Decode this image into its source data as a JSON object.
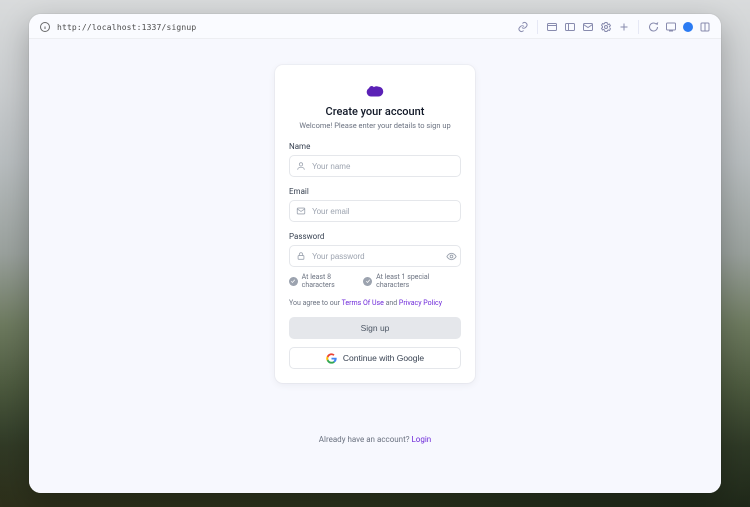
{
  "browser": {
    "url": "http://localhost:1337/signup"
  },
  "form": {
    "title": "Create your account",
    "subtitle": "Welcome! Please enter your details to sign up",
    "name_label": "Name",
    "name_placeholder": "Your name",
    "email_label": "Email",
    "email_placeholder": "Your email",
    "password_label": "Password",
    "password_placeholder": "Your password",
    "req1": "At least 8 characters",
    "req2": "At least 1 special characters",
    "agree_prefix": "You agree to our ",
    "terms_label": "Terms Of Use",
    "agree_mid": " and ",
    "privacy_label": "Privacy Policy",
    "signup_label": "Sign up",
    "google_label": "Continue with Google"
  },
  "footer": {
    "prompt": "Already have an account? ",
    "login_label": "Login"
  }
}
